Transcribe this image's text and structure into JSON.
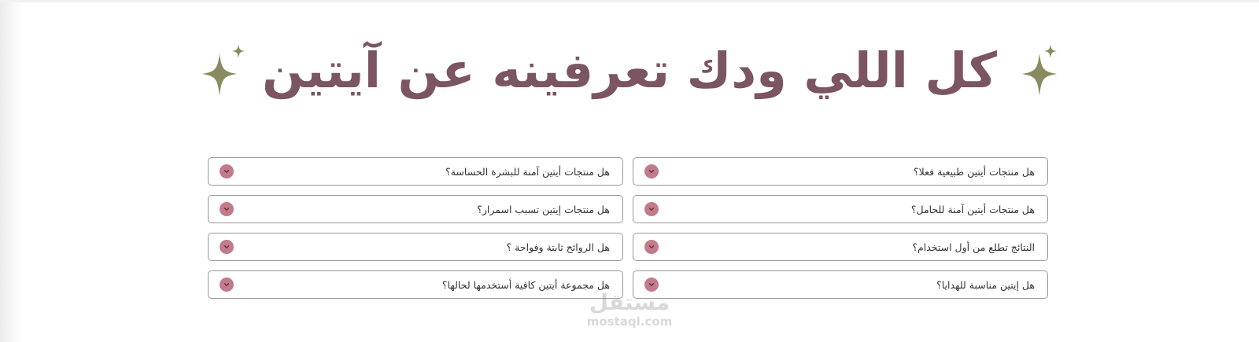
{
  "heading": {
    "title": "كل اللي ودك تعرفينه عن آيتين"
  },
  "colors": {
    "title": "#7b5561",
    "sparkle": "#8a8a60",
    "toggle": "#c27b8a",
    "border": "#9a9a9a"
  },
  "faq": {
    "items": [
      {
        "question": "هل منتجات أيتين طبيعية فعلا؟"
      },
      {
        "question": "هل منتجات أيتين آمنة للبشرة الحساسة؟"
      },
      {
        "question": "هل منتجات أيتين آمنة للحامل؟"
      },
      {
        "question": "هل منتجات إيتين تسبب اسمرار؟"
      },
      {
        "question": "النتائج تطلع من أول استخدام؟"
      },
      {
        "question": "هل الروائح ثابتة وفواحة ؟"
      },
      {
        "question": "هل إيتين مناسبة للهدايا؟"
      },
      {
        "question": "هل مجموعة أيتين كافية أستخدمها لحالها؟"
      }
    ]
  },
  "watermark": {
    "arabic": "مستقل",
    "latin": "mostaql.com"
  }
}
